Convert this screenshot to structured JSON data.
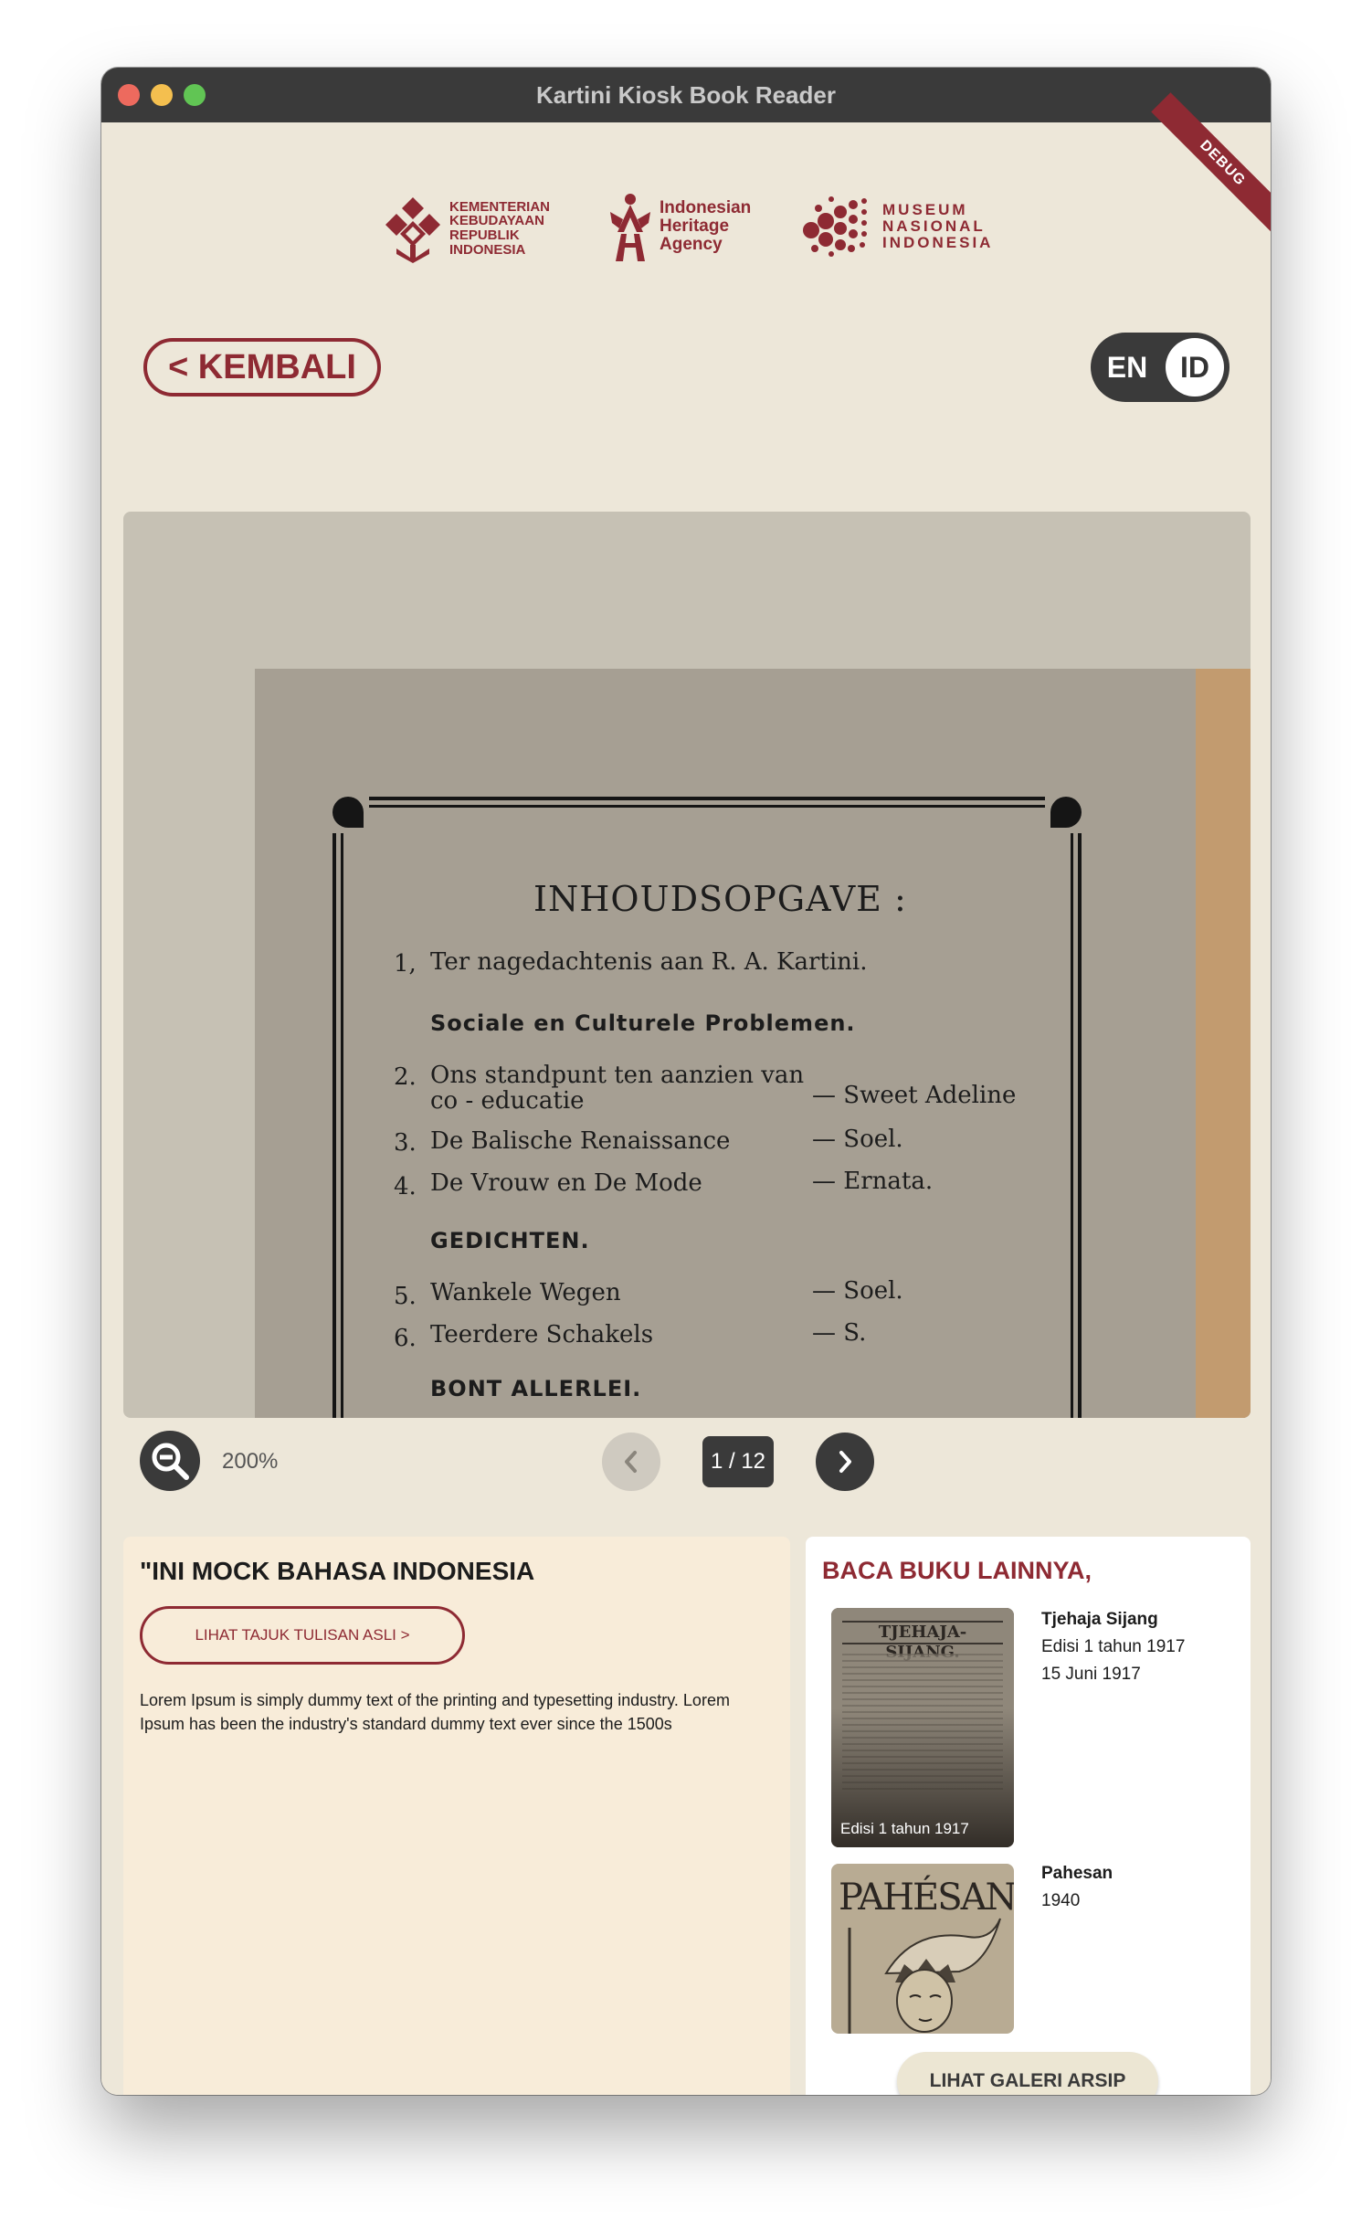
{
  "window": {
    "title": "Kartini Kiosk Book Reader"
  },
  "debug_ribbon": "DEBUG",
  "logos": {
    "kementerian": [
      "KEMENTERIAN",
      "KEBUDAYAAN",
      "REPUBLIK",
      "INDONESIA"
    ],
    "heritage": [
      "Indonesian",
      "Heritage",
      "Agency"
    ],
    "museum": [
      "MUSEUM",
      "NASIONAL",
      "INDONESIA"
    ]
  },
  "nav": {
    "back_label": "< KEMBALI",
    "lang_en": "EN",
    "lang_id": "ID",
    "active_lang": "ID"
  },
  "document": {
    "title": "INHOUDSOPGAVE :",
    "items": [
      {
        "num": "1,",
        "text": "Ter nagedachtenis aan R. A. Kartini.",
        "author": ""
      },
      {
        "num": "2.",
        "text": "Ons standpunt ten aanzien van",
        "text2": "co - educatie",
        "author": "— Sweet Adeline"
      },
      {
        "num": "3.",
        "text": "De Balische Renaissance",
        "author": "— Soel."
      },
      {
        "num": "4.",
        "text": "De Vrouw en De Mode",
        "author": "— Ernata."
      },
      {
        "num": "5.",
        "text": "Wankele Wegen",
        "author": "— Soel."
      },
      {
        "num": "6.",
        "text": "Teerdere Schakels",
        "author": "— S."
      }
    ],
    "sections": [
      "Sociale en Culturele Problemen.",
      "GEDICHTEN.",
      "BONT ALLERLEI."
    ]
  },
  "controls": {
    "zoom_level": "200%",
    "page_indicator": "1 / 12"
  },
  "info": {
    "title": "\"INI MOCK BAHASA INDONESIA",
    "button_label": "LIHAT TAJUK TULISAN ASLI >",
    "body": "Lorem Ipsum is simply dummy text of the printing and typesetting industry. Lorem Ipsum has been the industry's standard dummy text ever since the 1500s"
  },
  "other_books": {
    "title": "BACA BUKU LAINNYA,",
    "books": [
      {
        "cover_text": "TJEHAJA-SIJANG.",
        "caption": "Edisi 1 tahun 1917",
        "name": "Tjehaja Sijang",
        "line1": "Edisi 1 tahun 1917",
        "line2": "15 Juni 1917"
      },
      {
        "cover_text": "PAHÉSAN",
        "caption": "",
        "name": "Pahesan",
        "line1": "1940",
        "line2": ""
      }
    ],
    "gallery_button": "LIHAT GALERI ARSIP"
  },
  "colors": {
    "brand": "#8e2a33",
    "dark": "#3a3a3a",
    "background": "#ede7d9",
    "info_panel": "#f8ecd9"
  },
  "icons": [
    "zoom-out-icon",
    "chevron-left-icon",
    "chevron-right-icon",
    "kementerian-logo",
    "heritage-agency-logo",
    "museum-logo"
  ]
}
